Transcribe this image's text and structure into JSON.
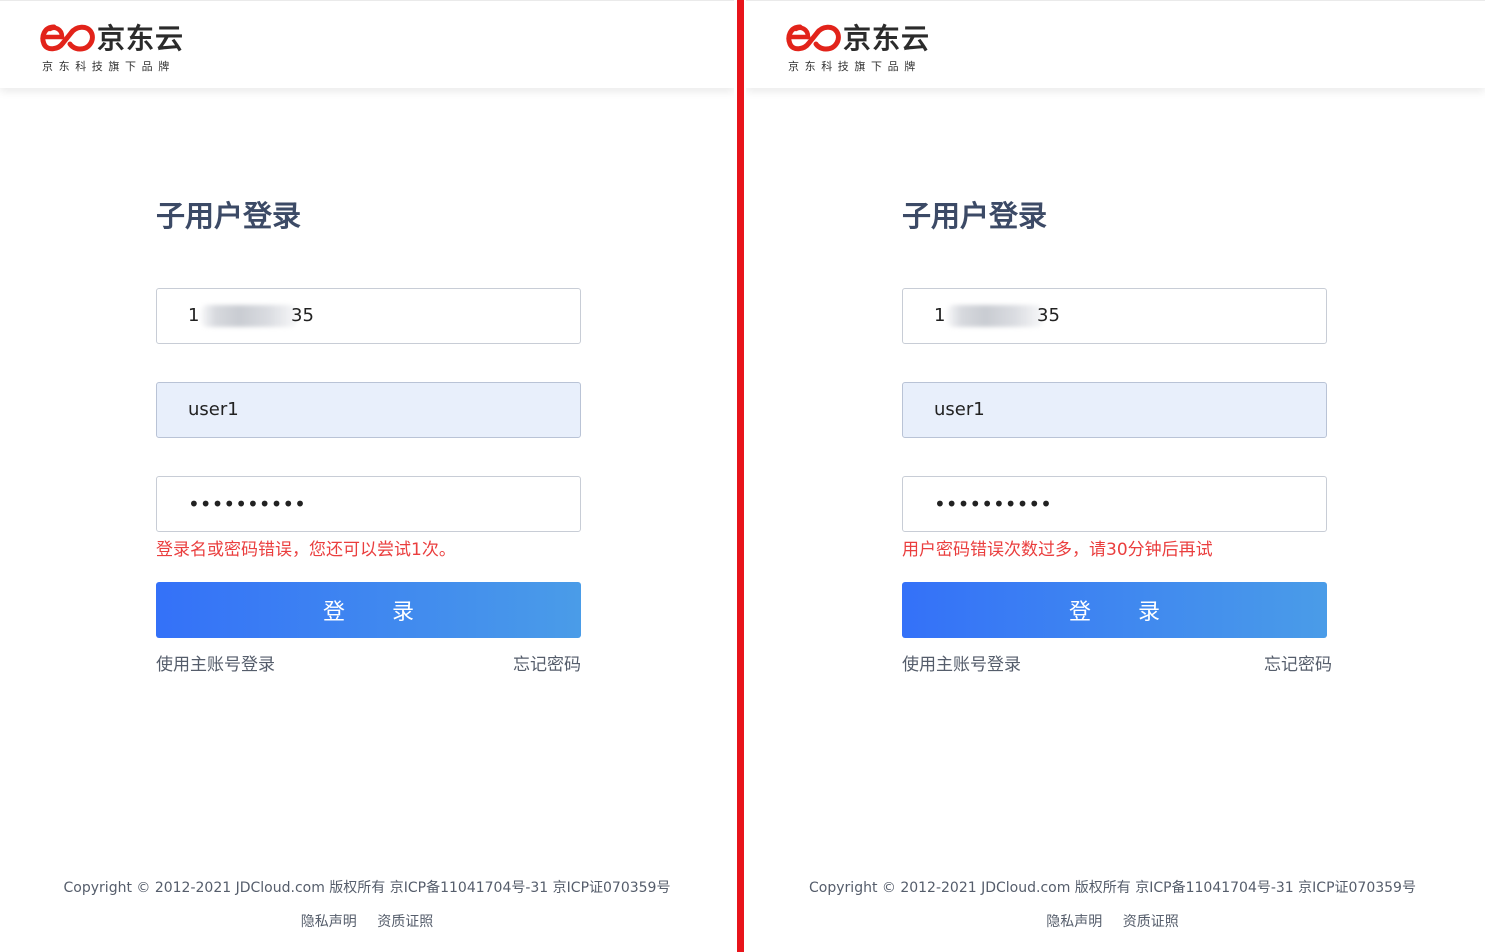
{
  "brand": {
    "logo_text": "京东云",
    "logo_subtext": "京东科技旗下品牌",
    "logo_color": "#e2231a"
  },
  "divider_color": "#e8141b",
  "panels": [
    {
      "title": "子用户登录",
      "account": {
        "visible_prefix": "1",
        "visible_suffix": "35",
        "masked": true
      },
      "username": "user1",
      "password_mask": "••••••••••",
      "error": "登录名或密码错误，您还可以尝试1次。",
      "login_button": "登 录",
      "main_account_link": "使用主账号登录",
      "forgot_link": "忘记密码",
      "footer": {
        "copyright": "Copyright © 2012-2021 JDCloud.com 版权所有 京ICP备11041704号-31 京ICP证070359号",
        "privacy": "隐私声明",
        "qualification": "资质证照"
      }
    },
    {
      "title": "子用户登录",
      "account": {
        "visible_prefix": "1",
        "visible_suffix": "35",
        "masked": true
      },
      "username": "user1",
      "password_mask": "••••••••••",
      "error": "用户密码错误次数过多，请30分钟后再试",
      "login_button": "登 录",
      "main_account_link": "使用主账号登录",
      "forgot_link": "忘记密码",
      "footer": {
        "copyright": "Copyright © 2012-2021 JDCloud.com 版权所有 京ICP备11041704号-31 京ICP证070359号",
        "privacy": "隐私声明",
        "qualification": "资质证照"
      }
    }
  ]
}
